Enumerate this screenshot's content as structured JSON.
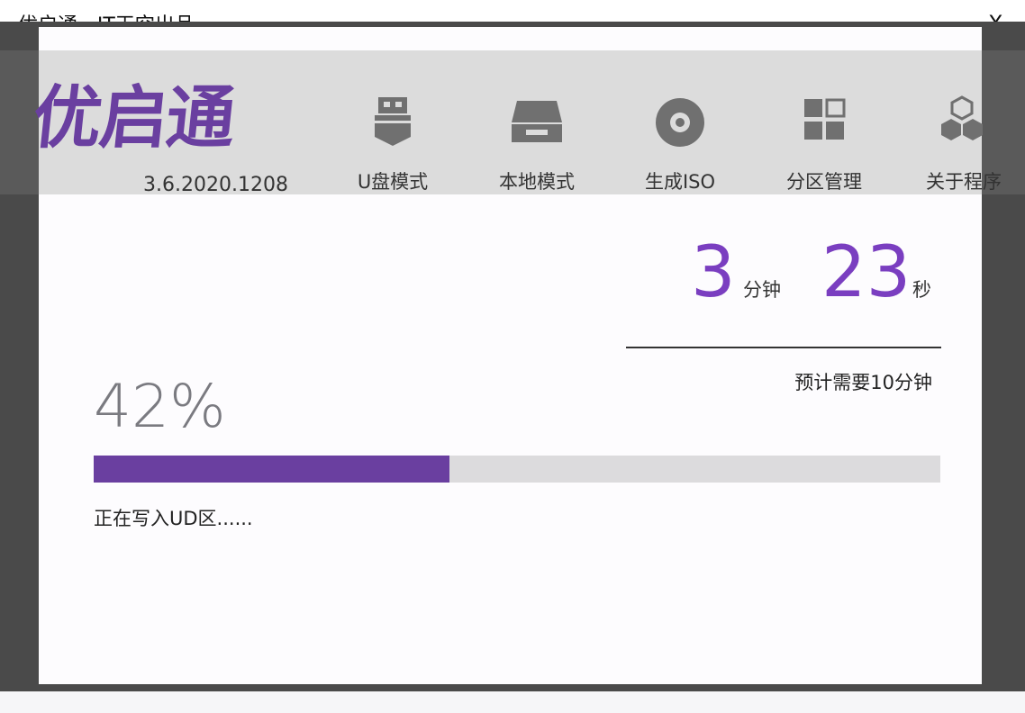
{
  "window": {
    "title": "优启通 - IT天空出品",
    "close_label": "X"
  },
  "app": {
    "logo_text": "优启通",
    "version": "3.6.2020.1208",
    "brand_color": "#6a3fa0"
  },
  "nav": {
    "items": [
      {
        "label": "U盘模式",
        "icon": "usb-drive-icon"
      },
      {
        "label": "本地模式",
        "icon": "hard-drive-icon"
      },
      {
        "label": "生成ISO",
        "icon": "disc-icon"
      },
      {
        "label": "分区管理",
        "icon": "partition-grid-icon"
      },
      {
        "label": "关于程序",
        "icon": "hexagons-icon"
      }
    ]
  },
  "timer": {
    "minutes": "3",
    "minutes_unit": "分钟",
    "seconds": "23",
    "seconds_unit": "秒",
    "estimate": "预计需要10分钟",
    "accent_color": "#7a3ec0"
  },
  "progress": {
    "percent_text": "42%",
    "percent": 42,
    "status": "正在写入UD区......",
    "fill_color": "#6a3fa0",
    "track_color": "#dcdbdd"
  }
}
